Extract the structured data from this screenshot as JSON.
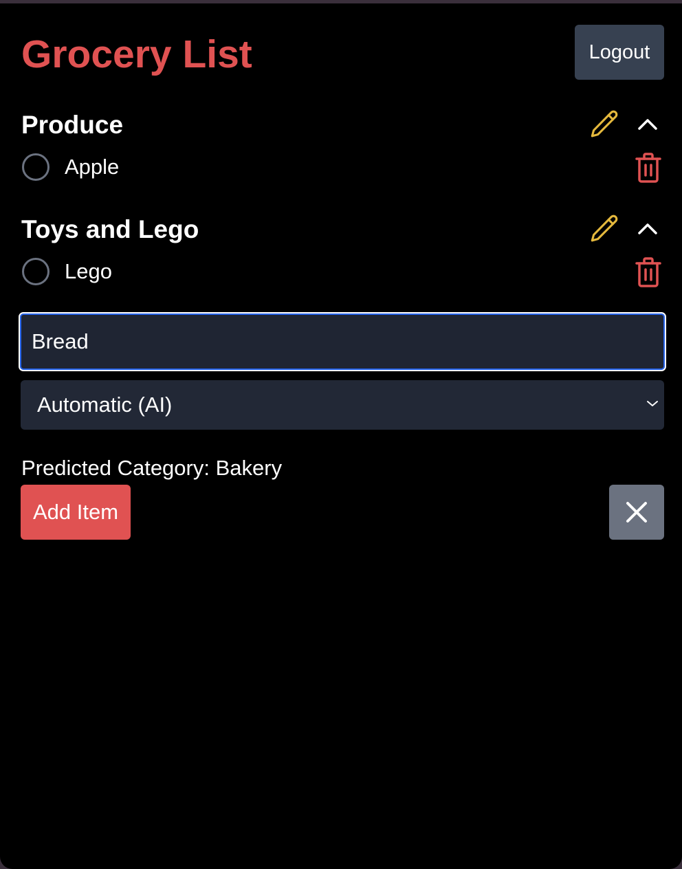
{
  "header": {
    "title": "Grocery List",
    "logout_label": "Logout"
  },
  "categories": [
    {
      "name": "Produce",
      "items": [
        {
          "label": "Apple",
          "checked": false
        }
      ]
    },
    {
      "name": "Toys and Lego",
      "items": [
        {
          "label": "Lego",
          "checked": false
        }
      ]
    }
  ],
  "new_item": {
    "input_value": "Bread",
    "category_select_value": "Automatic (AI)",
    "prediction_text": "Predicted Category: Bakery",
    "add_label": "Add Item"
  },
  "icons": {
    "edit": "pencil-icon",
    "collapse": "chevron-up-icon",
    "delete": "trash-icon",
    "select": "chevron-down-icon",
    "cancel": "close-icon"
  },
  "colors": {
    "accent": "#e05252",
    "edit_icon": "#e5b93d",
    "delete_icon": "#e05252",
    "input_focus": "#2563eb",
    "button_secondary": "#374151",
    "button_close": "#6b7280"
  }
}
